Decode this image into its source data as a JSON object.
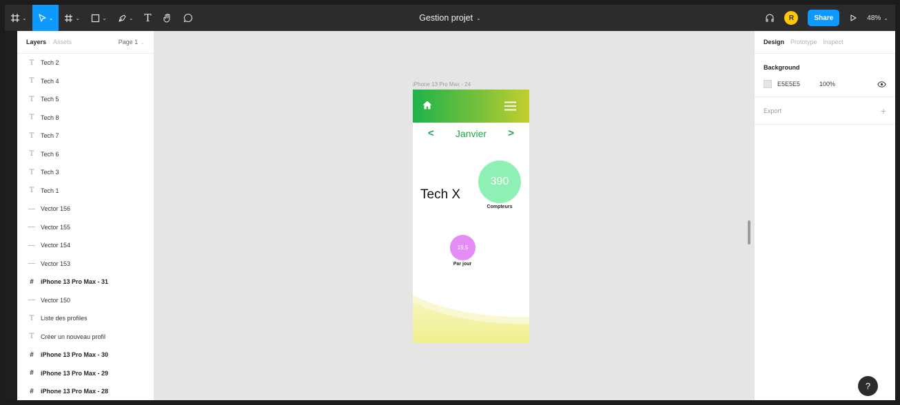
{
  "toolbar": {
    "file_name": "Gestion projet",
    "avatar_initial": "R",
    "share_label": "Share",
    "zoom": "48%",
    "text_tool_glyph": "T",
    "icons": [
      "figma-menu-icon",
      "move-tool-icon",
      "frame-tool-icon",
      "shape-tool-icon",
      "pen-tool-icon",
      "text-tool-icon",
      "hand-tool-icon",
      "comment-tool-icon",
      "headphones-icon",
      "play-icon"
    ]
  },
  "layers_panel": {
    "tabs": [
      "Layers",
      "Assets"
    ],
    "page": "Page 1",
    "items": [
      {
        "label": "Tech 2",
        "type": "text"
      },
      {
        "label": "Tech 4",
        "type": "text"
      },
      {
        "label": "Tech 5",
        "type": "text"
      },
      {
        "label": "Tech 8",
        "type": "text"
      },
      {
        "label": "Tech 7",
        "type": "text"
      },
      {
        "label": "Tech 6",
        "type": "text"
      },
      {
        "label": "Tech 3",
        "type": "text"
      },
      {
        "label": "Tech 1",
        "type": "text"
      },
      {
        "label": "Vector 156",
        "type": "vector"
      },
      {
        "label": "Vector 155",
        "type": "vector"
      },
      {
        "label": "Vector 154",
        "type": "vector"
      },
      {
        "label": "Vector 153",
        "type": "vector"
      },
      {
        "label": "iPhone 13 Pro Max - 31",
        "type": "frame"
      },
      {
        "label": "Vector 150",
        "type": "vector"
      },
      {
        "label": "Liste des profiles",
        "type": "text"
      },
      {
        "label": "Créer un nouveau profil",
        "type": "text"
      },
      {
        "label": "iPhone 13 Pro Max - 30",
        "type": "frame"
      },
      {
        "label": "iPhone 13 Pro Max - 29",
        "type": "frame"
      },
      {
        "label": "iPhone 13 Pro Max - 28",
        "type": "frame"
      }
    ]
  },
  "canvas": {
    "frame_label": "iPhone 13 Pro Max - 24",
    "phone": {
      "month": "Janvier",
      "prev_arrow": "<",
      "next_arrow": ">",
      "title": "Tech X",
      "counter_value": "390",
      "counter_label": "Compteurs",
      "daily_value": "19,5",
      "daily_label": "Par jour",
      "colors": {
        "header_start": "#1db34a",
        "header_end": "#c2cf2c",
        "accent": "#18a84a",
        "counter_circle": "#8ef0b5",
        "daily_circle": "#e48cf5",
        "wave": "#f3f3a0"
      }
    }
  },
  "design_panel": {
    "tabs": [
      "Design",
      "Prototype",
      "Inspect"
    ],
    "background_title": "Background",
    "background_hex": "E5E5E5",
    "background_opacity": "100%",
    "export_label": "Export",
    "help_label": "?"
  }
}
